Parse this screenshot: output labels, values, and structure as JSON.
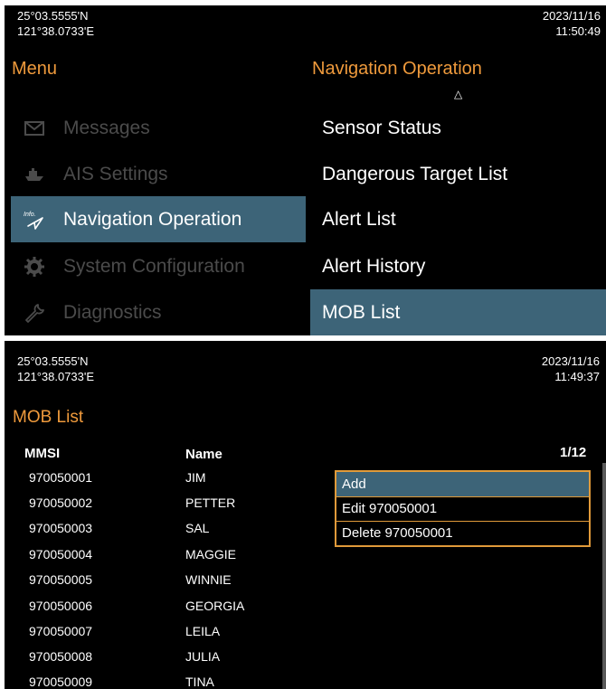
{
  "panel1": {
    "latitude": "25°03.5555'N",
    "longitude": "121°38.0733'E",
    "date": "2023/11/16",
    "time": "11:50:49",
    "menu_title": "Menu",
    "submenu_title": "Navigation Operation",
    "menu_items": [
      {
        "label": "Messages",
        "icon": "envelope-icon"
      },
      {
        "label": "AIS Settings",
        "icon": "ship-icon"
      },
      {
        "label": "Navigation Operation",
        "icon": "info-compass-icon",
        "active": true
      },
      {
        "label": "System Configuration",
        "icon": "gear-icon"
      },
      {
        "label": "Diagnostics",
        "icon": "wrench-icon"
      }
    ],
    "submenu_items": [
      {
        "label": "Sensor Status"
      },
      {
        "label": "Dangerous Target List"
      },
      {
        "label": "Alert List"
      },
      {
        "label": "Alert History"
      },
      {
        "label": "MOB List",
        "active": true
      }
    ],
    "icon_info_text": "Info."
  },
  "panel2": {
    "latitude": "25°03.5555'N",
    "longitude": "121°38.0733'E",
    "date": "2023/11/16",
    "time": "11:49:37",
    "title": "MOB List",
    "col_mmsi": "MMSI",
    "col_name": "Name",
    "page_indicator": "1/12",
    "rows": [
      {
        "mmsi": "970050001",
        "name": "JIM"
      },
      {
        "mmsi": "970050002",
        "name": "PETTER"
      },
      {
        "mmsi": "970050003",
        "name": "SAL"
      },
      {
        "mmsi": "970050004",
        "name": "MAGGIE"
      },
      {
        "mmsi": "970050005",
        "name": "WINNIE"
      },
      {
        "mmsi": "970050006",
        "name": "GEORGIA"
      },
      {
        "mmsi": "970050007",
        "name": "LEILA"
      },
      {
        "mmsi": "970050008",
        "name": "JULIA"
      },
      {
        "mmsi": "970050009",
        "name": "TINA"
      }
    ],
    "popup": {
      "add": "Add",
      "edit": "Edit 970050001",
      "delete": "Delete 970050001"
    }
  },
  "colors": {
    "background": "#000000",
    "accent_orange": "#ef9a3c",
    "selection_blue": "#3d6478",
    "disabled_gray": "#4b4b4b"
  }
}
